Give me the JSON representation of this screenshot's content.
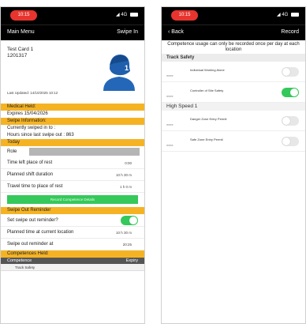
{
  "status_bar": {
    "time": "10:15",
    "indicators": "◢ 4G"
  },
  "left": {
    "nav": {
      "title": "Main Menu",
      "action": "Swipe In"
    },
    "card": {
      "name": "Test Card 1",
      "number": "1201317",
      "last_updated": "Last Updated: 14/10/2025 10:12"
    },
    "medical": {
      "title": "Medical Held:",
      "expiry": "Expires 15/04/2026"
    },
    "swipe_info": {
      "title": "Swipe Information:",
      "status": "Currently swiped in to :",
      "hours": "Hours since last swipe out : 863"
    },
    "today": {
      "title": "Today",
      "role_label": "Role",
      "rows": [
        {
          "label": "Time left place of rest",
          "value": "0:00"
        },
        {
          "label": "Planned shift duration",
          "value": "10 h 30 m"
        },
        {
          "label": "Travel time to place of rest",
          "value": "1 h 0 m"
        }
      ],
      "button": "Record Competence Details"
    },
    "reminder": {
      "title": "Swipe Out Reminder",
      "set_label": "Set swipe out reminder?",
      "rows": [
        {
          "label": "Planned time at current location",
          "value": "10 h 30 m"
        },
        {
          "label": "Swipe out reminder at",
          "value": "20:25"
        }
      ]
    },
    "competences": {
      "title": "Competences Held:",
      "col_name": "Competence",
      "col_expiry": "Expiry",
      "first_row": "Track Safety"
    }
  },
  "right": {
    "nav": {
      "back": "Back",
      "action": "Record"
    },
    "notice": "Competence usage can only be recorded once per day at each location",
    "sections": [
      {
        "title": "Track Safety",
        "items": [
          {
            "name": "Individual Working Alone",
            "enabled": false
          },
          {
            "name": "Controller of Site Safety",
            "enabled": true
          }
        ]
      },
      {
        "title": "High Speed 1",
        "items": [
          {
            "name": "Danger Zone Entry Permit",
            "enabled": false
          },
          {
            "name": "Safe Zone Entry Permit",
            "enabled": false
          }
        ]
      }
    ]
  },
  "colors": {
    "accent_band": "#f5b324",
    "toggle_on": "#35c85a",
    "record_button": "#35c85a",
    "time_pill": "#e8342e"
  }
}
